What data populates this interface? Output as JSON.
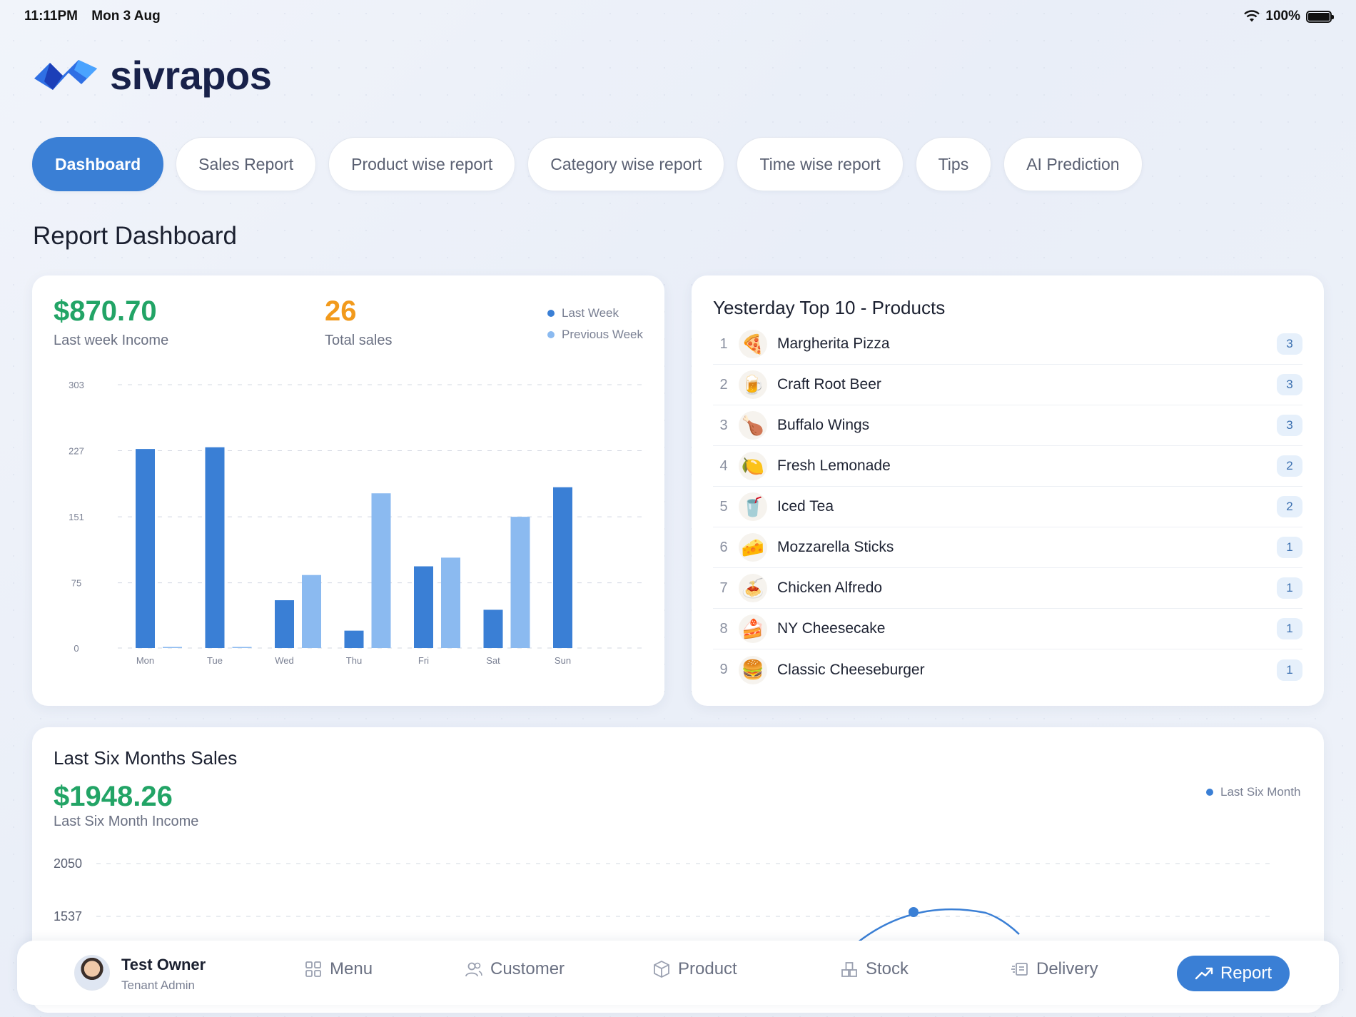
{
  "status_bar": {
    "time": "11:11PM",
    "date": "Mon 3 Aug",
    "battery": "100%"
  },
  "brand": {
    "name": "sivrapos"
  },
  "tabs": [
    {
      "label": "Dashboard",
      "active": true
    },
    {
      "label": "Sales Report",
      "active": false
    },
    {
      "label": "Product wise report",
      "active": false
    },
    {
      "label": "Category wise report",
      "active": false
    },
    {
      "label": "Time wise report",
      "active": false
    },
    {
      "label": "Tips",
      "active": false
    },
    {
      "label": "AI Prediction",
      "active": false
    }
  ],
  "page_title": "Report Dashboard",
  "weekly": {
    "income_value": "$870.70",
    "income_label": "Last week Income",
    "sales_value": "26",
    "sales_label": "Total sales",
    "legend_last": "Last Week",
    "legend_prev": "Previous Week"
  },
  "top_products": {
    "title": "Yesterday Top 10 - Products",
    "items": [
      {
        "rank": "1",
        "name": "Margherita Pizza",
        "count": "3",
        "icon": "pizza-icon"
      },
      {
        "rank": "2",
        "name": "Craft Root Beer",
        "count": "3",
        "icon": "beer-icon"
      },
      {
        "rank": "3",
        "name": "Buffalo Wings",
        "count": "3",
        "icon": "wings-icon"
      },
      {
        "rank": "4",
        "name": "Fresh Lemonade",
        "count": "2",
        "icon": "lemonade-icon"
      },
      {
        "rank": "5",
        "name": "Iced Tea",
        "count": "2",
        "icon": "iced-tea-icon"
      },
      {
        "rank": "6",
        "name": "Mozzarella Sticks",
        "count": "1",
        "icon": "mozzarella-icon"
      },
      {
        "rank": "7",
        "name": "Chicken Alfredo",
        "count": "1",
        "icon": "pasta-icon"
      },
      {
        "rank": "8",
        "name": "NY Cheesecake",
        "count": "1",
        "icon": "cheesecake-icon"
      },
      {
        "rank": "9",
        "name": "Classic Cheeseburger",
        "count": "1",
        "icon": "burger-icon"
      }
    ]
  },
  "six_months": {
    "title": "Last Six Months Sales",
    "income_value": "$1948.26",
    "income_label": "Last Six Month Income",
    "legend": "Last Six Month",
    "visible_ticks": [
      "2050",
      "1537"
    ]
  },
  "bottom_nav": {
    "user_name": "Test Owner",
    "user_role": "Tenant Admin",
    "items": [
      "Menu",
      "Customer",
      "Product",
      "Stock",
      "Delivery"
    ],
    "active": "Report"
  },
  "colors": {
    "accent": "#3a7fd5",
    "last_week": "#3a7fd5",
    "previous_week": "#8bbaf0",
    "income_green": "#22a466",
    "sales_orange": "#f29a1c"
  },
  "chart_data": [
    {
      "type": "bar",
      "categories": [
        "Mon",
        "Tue",
        "Wed",
        "Thu",
        "Fri",
        "Sat",
        "Sun"
      ],
      "series": [
        {
          "name": "Last Week",
          "values": [
            229,
            231,
            55,
            20,
            94,
            44,
            185
          ]
        },
        {
          "name": "Previous Week",
          "values": [
            1,
            1,
            84,
            178,
            104,
            151,
            0
          ]
        }
      ],
      "yticks": [
        "0",
        "75",
        "151",
        "227",
        "303"
      ],
      "ylim": [
        0,
        303
      ],
      "grid": true,
      "legend_position": "top-right"
    },
    {
      "type": "line",
      "series": [
        {
          "name": "Last Six Month",
          "values": []
        }
      ],
      "yticks": [
        "2050",
        "1537"
      ],
      "ylim": [
        1537,
        2050
      ],
      "grid": true,
      "legend_position": "top-right"
    }
  ]
}
